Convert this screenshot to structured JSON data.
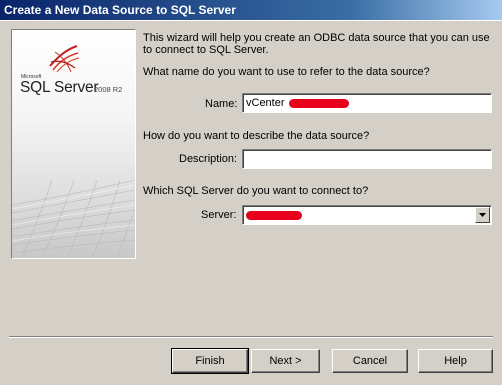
{
  "window": {
    "title": "Create a New Data Source to SQL Server"
  },
  "banner": {
    "brand_small": "Microsoft",
    "product": "SQL Server",
    "version": "2008 R2"
  },
  "intro": "This wizard will help you create an ODBC data source that you can use to connect to SQL Server.",
  "name_section": {
    "question": "What name do you want to use to refer to the data source?",
    "label": "Name:",
    "value": "vCenter"
  },
  "description_section": {
    "question": "How do you want to describe the data source?",
    "label": "Description:",
    "value": ""
  },
  "server_section": {
    "question": "Which SQL Server do you want to connect to?",
    "label": "Server:",
    "value": ""
  },
  "buttons": {
    "finish": "Finish",
    "next": "Next >",
    "cancel": "Cancel",
    "help": "Help"
  },
  "colors": {
    "titlebar": "#0a246a",
    "dialog_bg": "#d4d0c8",
    "redaction": "#e8001c"
  }
}
